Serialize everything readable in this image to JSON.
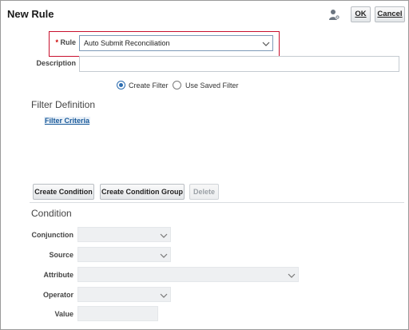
{
  "dialog": {
    "title": "New Rule",
    "ok_label": "OK",
    "cancel_label": "Cancel"
  },
  "rule": {
    "required_mark": "*",
    "label": "Rule",
    "value": "Auto Submit Reconciliation"
  },
  "description": {
    "label": "Description",
    "value": ""
  },
  "filter_mode": {
    "options": [
      "Create Filter",
      "Use Saved Filter"
    ],
    "selected": "Create Filter"
  },
  "filter_definition": {
    "heading": "Filter Definition",
    "criteria_link": "Filter Criteria"
  },
  "actions": {
    "create_condition": "Create Condition",
    "create_condition_group": "Create Condition Group",
    "delete": "Delete"
  },
  "condition": {
    "heading": "Condition",
    "fields": {
      "conjunction": "Conjunction",
      "source": "Source",
      "attribute": "Attribute",
      "operator": "Operator",
      "value": "Value"
    }
  },
  "icons": {
    "user": "user-settings-icon",
    "dropdown": "chevron-down-icon"
  },
  "colors": {
    "highlight": "#c8102e",
    "link": "#1a5a9a",
    "radio_selected": "#2b6cb0"
  }
}
